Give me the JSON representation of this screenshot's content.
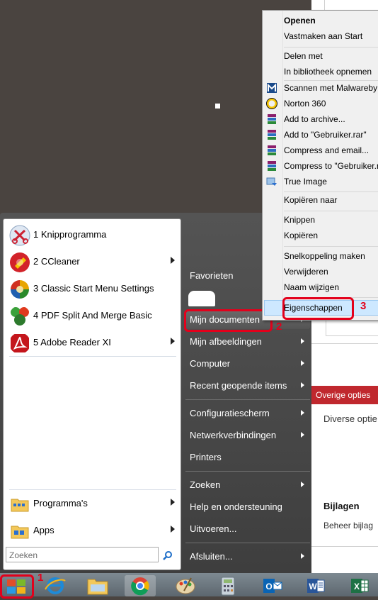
{
  "context_menu": {
    "items": [
      {
        "label": "Openen",
        "bold": true
      },
      {
        "label": "Vastmaken aan Start"
      },
      {
        "label": "Delen met"
      },
      {
        "label": "In bibliotheek opnemen"
      },
      {
        "label": "Scannen met Malwareby",
        "icon": "malwarebytes-icon"
      },
      {
        "label": "Norton 360",
        "icon": "norton-icon"
      },
      {
        "label": "Add to archive...",
        "icon": "winrar-icon"
      },
      {
        "label": "Add to \"Gebruiker.rar\"",
        "icon": "winrar-icon"
      },
      {
        "label": "Compress and email...",
        "icon": "winrar-icon"
      },
      {
        "label": "Compress to \"Gebruiker.r",
        "icon": "winrar-icon"
      },
      {
        "label": "True Image",
        "icon": "true-image-icon"
      },
      {
        "label": "Kopiëren naar"
      },
      {
        "label": "Knippen"
      },
      {
        "label": "Kopiëren"
      },
      {
        "label": "Snelkoppeling maken"
      },
      {
        "label": "Verwijderen"
      },
      {
        "label": "Naam wijzigen"
      },
      {
        "label": "Eigenschappen"
      }
    ]
  },
  "start_menu": {
    "programs": [
      {
        "label": "1 Knipprogramma",
        "icon": "snipping-tool-icon"
      },
      {
        "label": "2 CCleaner",
        "icon": "ccleaner-icon",
        "submenu": true
      },
      {
        "label": "3 Classic Start Menu Settings",
        "icon": "classic-shell-icon"
      },
      {
        "label": "4 PDF Split And Merge Basic",
        "icon": "pdfsam-icon"
      },
      {
        "label": "5 Adobe Reader XI",
        "icon": "adobe-reader-icon",
        "submenu": true
      }
    ],
    "bottom": [
      {
        "label": "Programma's",
        "icon": "programs-folder-icon",
        "submenu": true
      },
      {
        "label": "Apps",
        "icon": "apps-folder-icon",
        "submenu": true
      }
    ],
    "search_placeholder": "Zoeken",
    "right_items": [
      {
        "label": "Favorieten",
        "submenu": false
      },
      {
        "label": "Mijn documenten",
        "submenu": true
      },
      {
        "label": "Mijn afbeeldingen",
        "submenu": true
      },
      {
        "label": "Computer",
        "submenu": true
      },
      {
        "label": "Recent geopende items",
        "submenu": true
      },
      {
        "label": "Configuratiescherm",
        "submenu": true
      },
      {
        "label": "Netwerkverbindingen",
        "submenu": true
      },
      {
        "label": "Printers",
        "submenu": false
      },
      {
        "label": "Zoeken",
        "submenu": true
      },
      {
        "label": "Help en ondersteuning",
        "submenu": false
      },
      {
        "label": "Uitvoeren...",
        "submenu": false
      },
      {
        "label": "Afsluiten...",
        "submenu": true
      }
    ]
  },
  "background_window": {
    "tab": "Overige opties",
    "text1": "Diverse optie",
    "heading": "Bijlagen",
    "text2": "Beheer bijlag"
  },
  "annotations": {
    "n1": "1",
    "n2": "2",
    "n3": "3"
  },
  "taskbar": {
    "icons": [
      "start-icon",
      "internet-explorer-icon",
      "explorer-icon",
      "chrome-icon",
      "paint-icon",
      "calculator-icon",
      "outlook-icon",
      "word-icon",
      "excel-icon"
    ]
  },
  "colors": {
    "accent_red": "#e3001b",
    "tab_red": "#c0282e",
    "menu_highlight": "#cde8ff"
  }
}
